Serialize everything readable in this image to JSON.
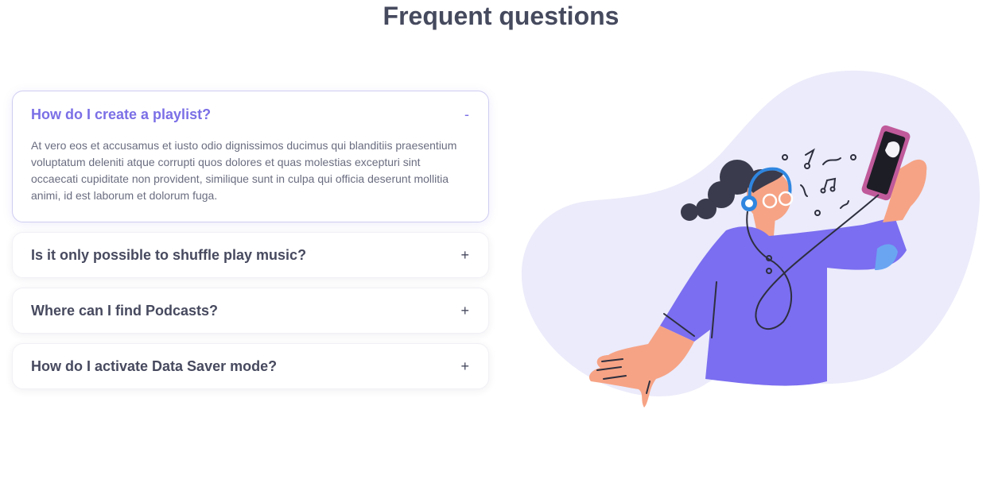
{
  "page": {
    "title": "Frequent questions"
  },
  "faq": {
    "items": [
      {
        "question": "How do I create a playlist?",
        "toggle": "-",
        "answer": "At vero eos et accusamus et iusto odio dignissimos ducimus qui blanditiis praesentium voluptatum deleniti atque corrupti quos dolores et quas molestias excepturi sint occaecati cupiditate non provident, similique sunt in culpa qui officia deserunt mollitia animi, id est laborum et dolorum fuga.",
        "expanded": true
      },
      {
        "question": "Is it only possible to shuffle play music?",
        "toggle": "+",
        "expanded": false
      },
      {
        "question": "Where can I find Podcasts?",
        "toggle": "+",
        "expanded": false
      },
      {
        "question": "How do I activate Data Saver mode?",
        "toggle": "+",
        "expanded": false
      }
    ]
  },
  "illustration": {
    "icon": "person-listening-music-illustration"
  },
  "colors": {
    "accent": "#7b6fe6",
    "heading": "#464a5e",
    "body_text": "#6a6d80",
    "blob": "#ebebfb",
    "shirt": "#7b6ef0",
    "skin": "#f6a385",
    "hair": "#3a3b4c",
    "headphones": "#2f86e0"
  }
}
